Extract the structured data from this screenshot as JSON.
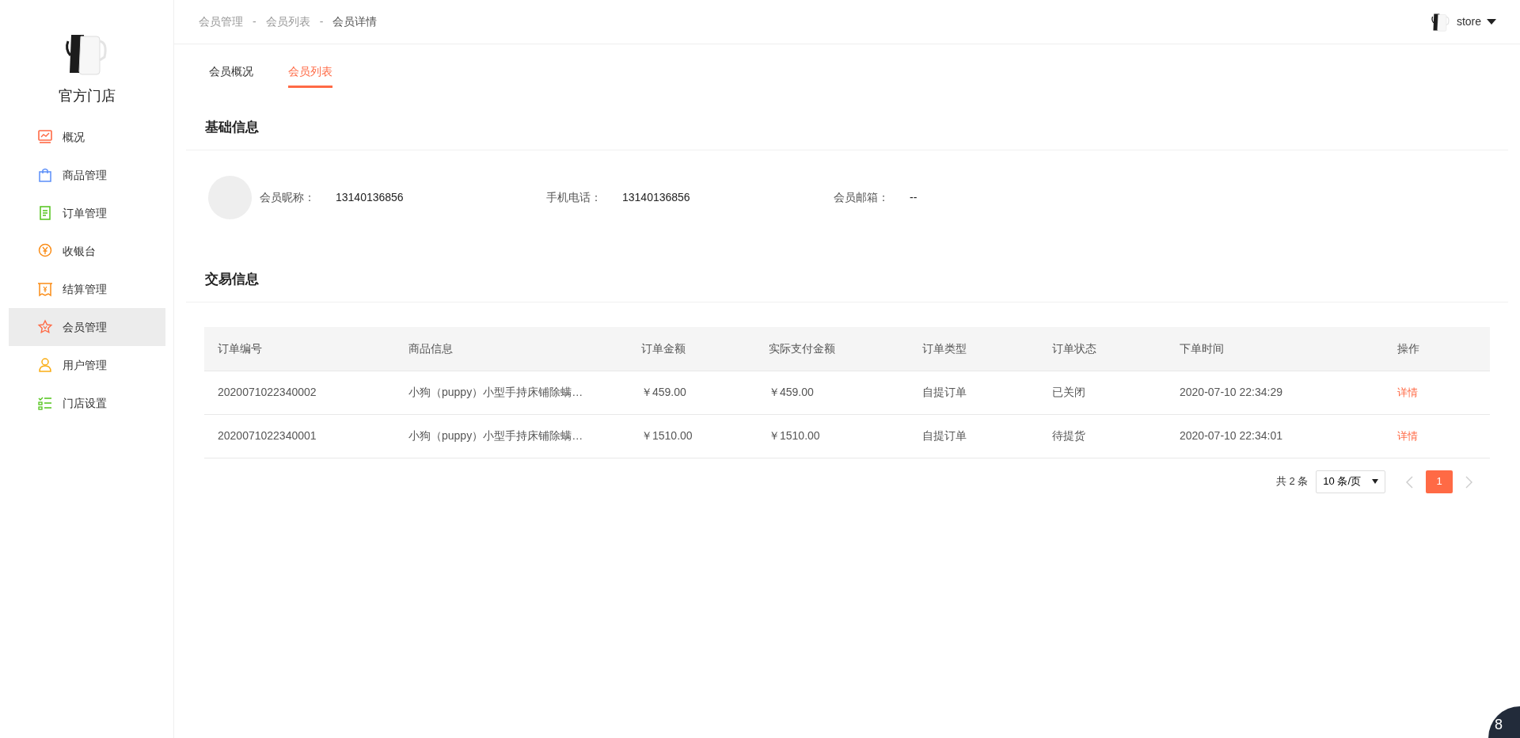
{
  "sidebar": {
    "store_name": "官方门店",
    "items": [
      {
        "label": "概况",
        "kind": "chart",
        "selected": false
      },
      {
        "label": "商品管理",
        "kind": "bag",
        "selected": false
      },
      {
        "label": "订单管理",
        "kind": "doc",
        "selected": false
      },
      {
        "label": "收银台",
        "kind": "yen",
        "selected": false
      },
      {
        "label": "结算管理",
        "kind": "receipt",
        "selected": false
      },
      {
        "label": "会员管理",
        "kind": "star",
        "selected": true
      },
      {
        "label": "用户管理",
        "kind": "user",
        "selected": false
      },
      {
        "label": "门店设置",
        "kind": "list",
        "selected": false
      }
    ]
  },
  "header": {
    "breadcrumb": [
      {
        "label": "会员管理",
        "current": false
      },
      {
        "label": "会员列表",
        "current": false
      },
      {
        "label": "会员详情",
        "current": true
      }
    ],
    "separators": [
      "-",
      "-"
    ],
    "user": "store"
  },
  "tabs": [
    {
      "label": "会员概况",
      "selected": false
    },
    {
      "label": "会员列表",
      "selected": true
    }
  ],
  "basic_info": {
    "title": "基础信息",
    "fields": [
      {
        "label": "会员昵称：",
        "value": "13140136856"
      },
      {
        "label": "手机电话：",
        "value": "13140136856"
      },
      {
        "label": "会员邮箱：",
        "value": "--"
      }
    ]
  },
  "transactions": {
    "title": "交易信息",
    "table": {
      "columns": [
        "订单编号",
        "商品信息",
        "订单金额",
        "实际支付金额",
        "订单类型",
        "订单状态",
        "下单时间",
        "操作"
      ],
      "rows": [
        {
          "cells": [
            "2020071022340002",
            "小狗（puppy）小型手持床铺除螨…",
            "￥459.00",
            "￥459.00",
            "自提订单",
            "已关闭",
            "2020-07-10 22:34:29"
          ],
          "action": "详情"
        },
        {
          "cells": [
            "2020071022340001",
            "小狗（puppy）小型手持床铺除螨…",
            "￥1510.00",
            "￥1510.00",
            "自提订单",
            "待提货",
            "2020-07-10 22:34:01"
          ],
          "action": "详情"
        }
      ]
    },
    "pagination": {
      "total": "共 2 条",
      "page_size": "10 条/页",
      "pages": [
        {
          "label": "1",
          "selected": true
        }
      ],
      "prev_disabled": true,
      "next_disabled": true
    }
  },
  "float_badge": "8"
}
